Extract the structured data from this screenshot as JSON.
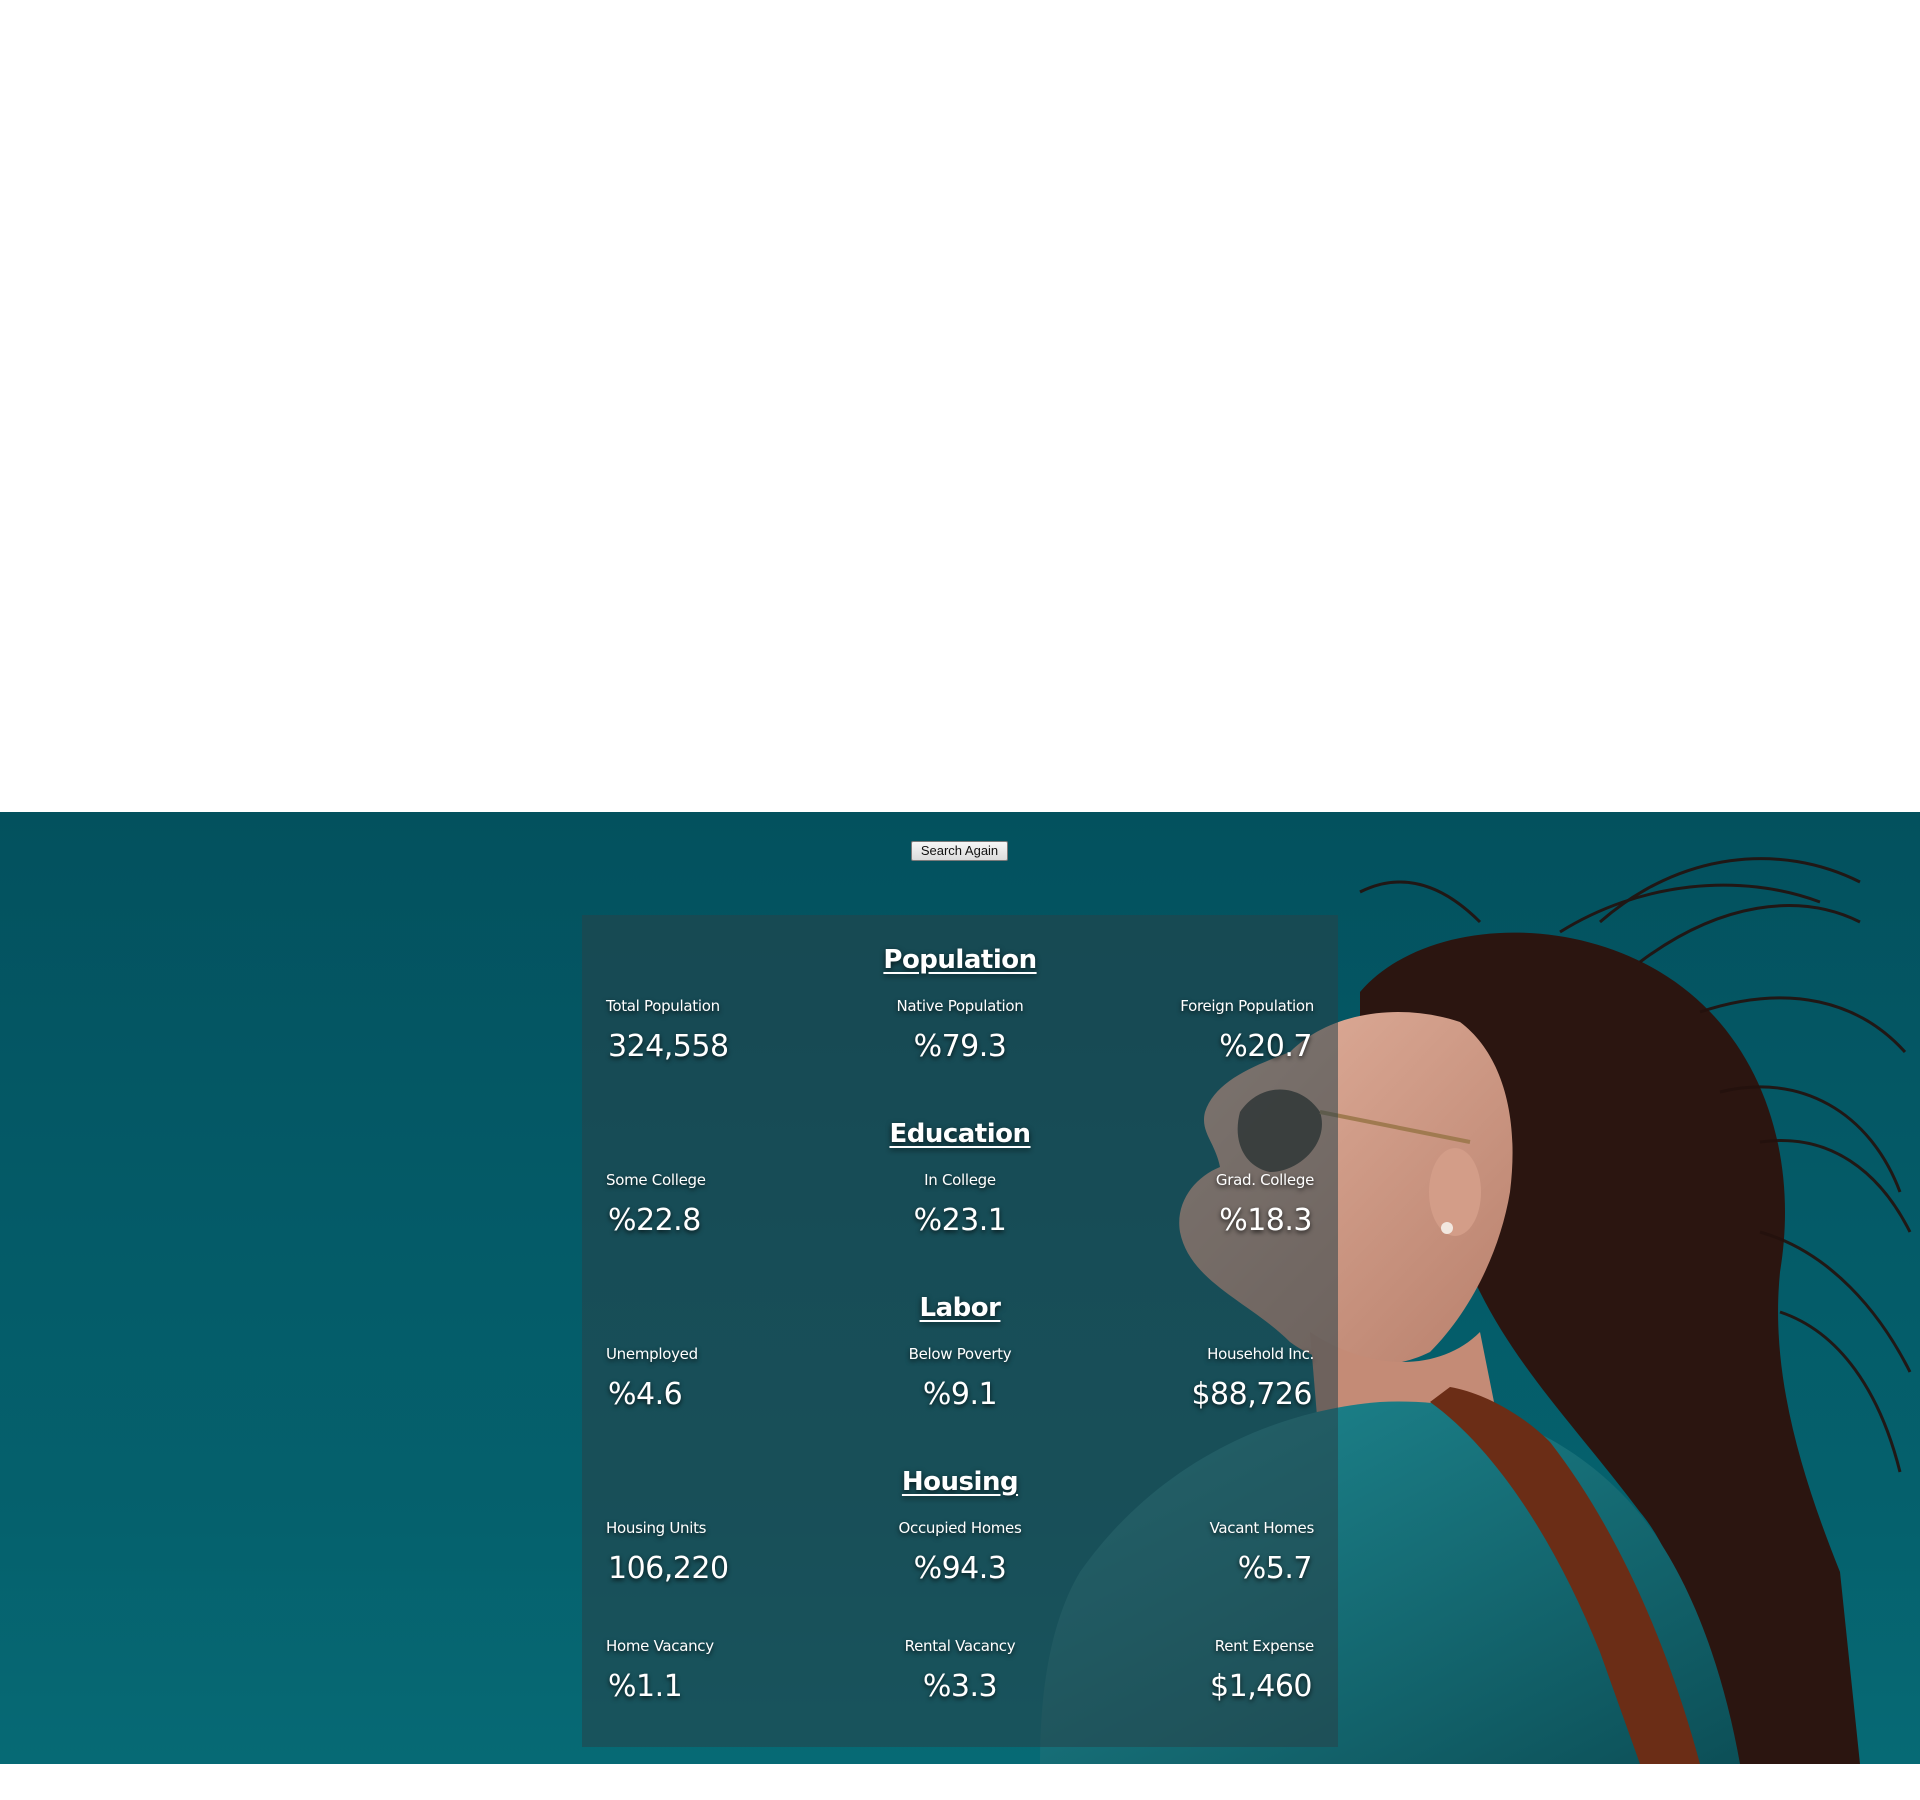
{
  "search_button_label": "Search Again",
  "colors": {
    "background_teal": "#045a67",
    "panel": "#2c484e",
    "text": "#ffffff"
  },
  "sections": [
    {
      "title": "Population",
      "stats": [
        {
          "label": "Total Population",
          "value": "324,558"
        },
        {
          "label": "Native Population",
          "value": "%79.3"
        },
        {
          "label": "Foreign Population",
          "value": "%20.7"
        }
      ]
    },
    {
      "title": "Education",
      "stats": [
        {
          "label": "Some College",
          "value": "%22.8"
        },
        {
          "label": "In College",
          "value": "%23.1"
        },
        {
          "label": "Grad. College",
          "value": "%18.3"
        }
      ]
    },
    {
      "title": "Labor",
      "stats": [
        {
          "label": "Unemployed",
          "value": "%4.6"
        },
        {
          "label": "Below Poverty",
          "value": "%9.1"
        },
        {
          "label": "Household Inc.",
          "value": "$88,726"
        }
      ]
    },
    {
      "title": "Housing",
      "stats": [
        {
          "label": "Housing Units",
          "value": "106,220"
        },
        {
          "label": "Occupied Homes",
          "value": "%94.3"
        },
        {
          "label": "Vacant Homes",
          "value": "%5.7"
        },
        {
          "label": "Home Vacancy",
          "value": "%1.1"
        },
        {
          "label": "Rental Vacancy",
          "value": "%3.3"
        },
        {
          "label": "Rent Expense",
          "value": "$1,460"
        }
      ]
    }
  ]
}
